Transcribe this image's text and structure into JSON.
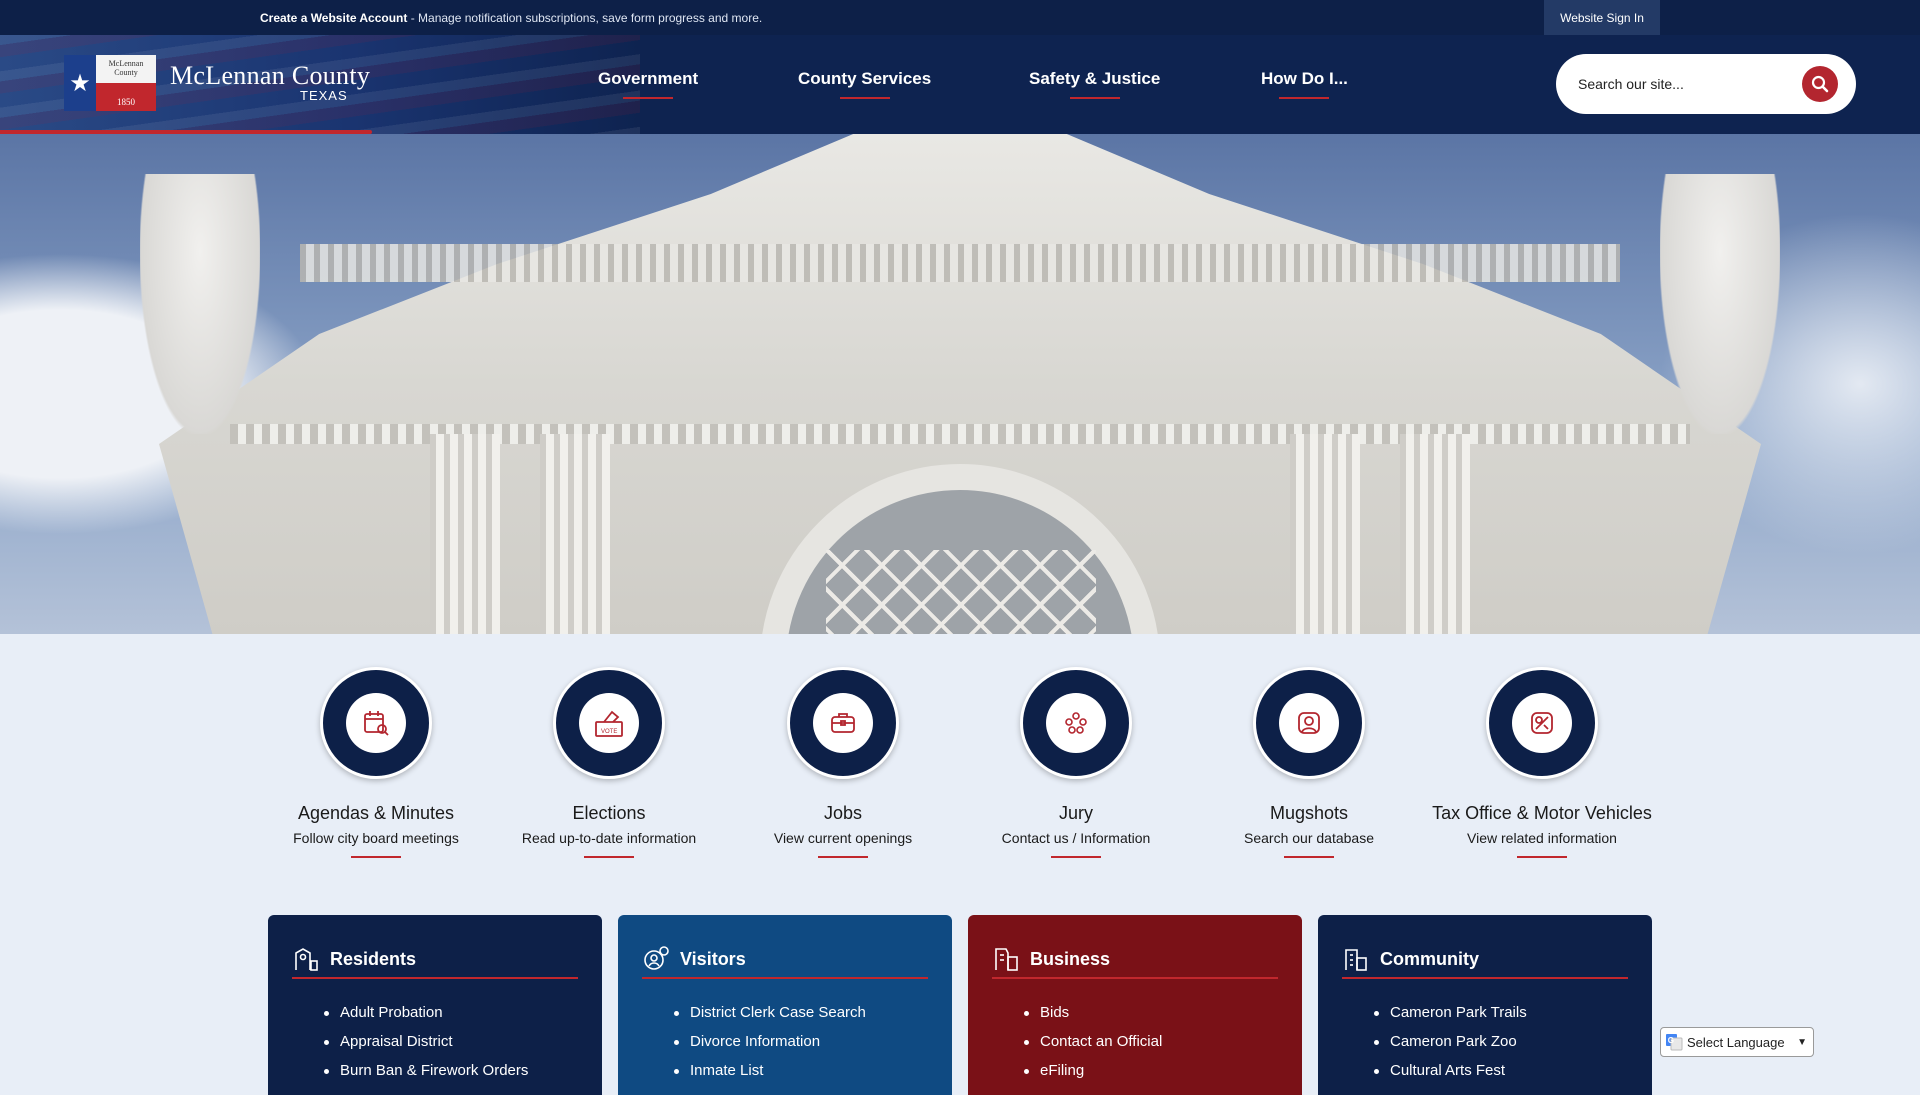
{
  "topbar": {
    "create_account": "Create a Website Account",
    "notice": " - Manage notification subscriptions, save form progress and more.",
    "sign_in": "Website Sign In"
  },
  "header": {
    "logo_seal_county": "McLennan County",
    "logo_seal_year": "1850",
    "logo_name": "McLennan County",
    "logo_state": "TEXAS",
    "nav": [
      {
        "label": "Government"
      },
      {
        "label": "County Services"
      },
      {
        "label": "Safety & Justice"
      },
      {
        "label": "How Do I..."
      }
    ],
    "search_placeholder": "Search our site...",
    "accent_color": "#c1272d",
    "navy_color": "#0d2048"
  },
  "quick_links": [
    {
      "title": "Agendas & Minutes",
      "subtitle": "Follow city board meetings",
      "icon": "calendar-search-icon"
    },
    {
      "title": "Elections",
      "subtitle": "Read up-to-date information",
      "icon": "vote-box-icon"
    },
    {
      "title": "Jobs",
      "subtitle": "View current openings",
      "icon": "briefcase-icon"
    },
    {
      "title": "Jury",
      "subtitle": "Contact us / Information",
      "icon": "group-icon"
    },
    {
      "title": "Mugshots",
      "subtitle": "Search our database",
      "icon": "user-portrait-icon"
    },
    {
      "title": "Tax Office & Motor Vehicles",
      "subtitle": "View related information",
      "icon": "map-tag-icon"
    }
  ],
  "cards": [
    {
      "title": "Residents",
      "color": "#0d2048",
      "icon": "residents-icon",
      "items": [
        "Adult Probation",
        "Appraisal District",
        "Burn Ban & Firework Orders"
      ]
    },
    {
      "title": "Visitors",
      "color": "#0f4a82",
      "icon": "visitors-icon",
      "items": [
        "District Clerk Case Search",
        "Divorce Information",
        "Inmate List"
      ]
    },
    {
      "title": "Business",
      "color": "#7a1117",
      "icon": "business-icon",
      "items": [
        "Bids",
        "Contact an Official",
        "eFiling"
      ]
    },
    {
      "title": "Community",
      "color": "#0d2048",
      "icon": "community-icon",
      "items": [
        "Cameron Park Trails",
        "Cameron Park Zoo",
        "Cultural Arts Fest"
      ]
    }
  ],
  "translate": {
    "label": "Select Language"
  }
}
